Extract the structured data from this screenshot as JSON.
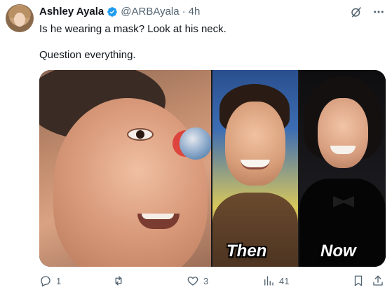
{
  "tweet": {
    "author_name": "Ashley Ayala",
    "handle": "@ARBAyala",
    "separator": "·",
    "time": "4h",
    "text_line1": "Is he wearing a mask? Look at his neck.",
    "text_line2": "Question everything."
  },
  "media": {
    "caption_then": "Then",
    "caption_now": "Now"
  },
  "actions": {
    "reply_count": "1",
    "retweet_count": "",
    "like_count": "3",
    "views_count": "41"
  },
  "colors": {
    "verified": "#1d9bf0",
    "text_primary": "#0f1419",
    "text_secondary": "#536471"
  },
  "icons": [
    "grok-icon",
    "more-icon",
    "reply-icon",
    "retweet-icon",
    "like-icon",
    "views-icon",
    "bookmark-icon",
    "share-icon",
    "verified-badge-icon"
  ]
}
